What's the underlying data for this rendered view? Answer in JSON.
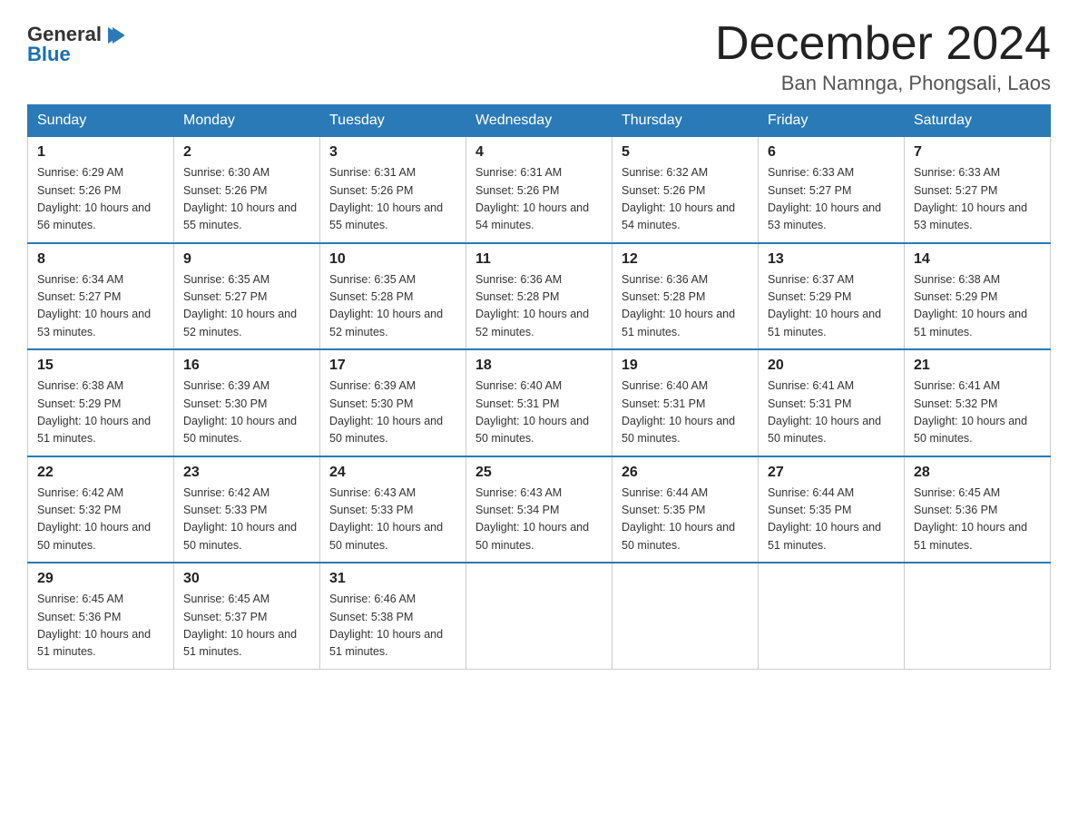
{
  "header": {
    "logo_line1": "General",
    "logo_line2": "Blue",
    "month_title": "December 2024",
    "location": "Ban Namnga, Phongsali, Laos"
  },
  "calendar": {
    "days_of_week": [
      "Sunday",
      "Monday",
      "Tuesday",
      "Wednesday",
      "Thursday",
      "Friday",
      "Saturday"
    ],
    "weeks": [
      [
        {
          "day": "1",
          "sunrise": "6:29 AM",
          "sunset": "5:26 PM",
          "daylight": "10 hours and 56 minutes."
        },
        {
          "day": "2",
          "sunrise": "6:30 AM",
          "sunset": "5:26 PM",
          "daylight": "10 hours and 55 minutes."
        },
        {
          "day": "3",
          "sunrise": "6:31 AM",
          "sunset": "5:26 PM",
          "daylight": "10 hours and 55 minutes."
        },
        {
          "day": "4",
          "sunrise": "6:31 AM",
          "sunset": "5:26 PM",
          "daylight": "10 hours and 54 minutes."
        },
        {
          "day": "5",
          "sunrise": "6:32 AM",
          "sunset": "5:26 PM",
          "daylight": "10 hours and 54 minutes."
        },
        {
          "day": "6",
          "sunrise": "6:33 AM",
          "sunset": "5:27 PM",
          "daylight": "10 hours and 53 minutes."
        },
        {
          "day": "7",
          "sunrise": "6:33 AM",
          "sunset": "5:27 PM",
          "daylight": "10 hours and 53 minutes."
        }
      ],
      [
        {
          "day": "8",
          "sunrise": "6:34 AM",
          "sunset": "5:27 PM",
          "daylight": "10 hours and 53 minutes."
        },
        {
          "day": "9",
          "sunrise": "6:35 AM",
          "sunset": "5:27 PM",
          "daylight": "10 hours and 52 minutes."
        },
        {
          "day": "10",
          "sunrise": "6:35 AM",
          "sunset": "5:28 PM",
          "daylight": "10 hours and 52 minutes."
        },
        {
          "day": "11",
          "sunrise": "6:36 AM",
          "sunset": "5:28 PM",
          "daylight": "10 hours and 52 minutes."
        },
        {
          "day": "12",
          "sunrise": "6:36 AM",
          "sunset": "5:28 PM",
          "daylight": "10 hours and 51 minutes."
        },
        {
          "day": "13",
          "sunrise": "6:37 AM",
          "sunset": "5:29 PM",
          "daylight": "10 hours and 51 minutes."
        },
        {
          "day": "14",
          "sunrise": "6:38 AM",
          "sunset": "5:29 PM",
          "daylight": "10 hours and 51 minutes."
        }
      ],
      [
        {
          "day": "15",
          "sunrise": "6:38 AM",
          "sunset": "5:29 PM",
          "daylight": "10 hours and 51 minutes."
        },
        {
          "day": "16",
          "sunrise": "6:39 AM",
          "sunset": "5:30 PM",
          "daylight": "10 hours and 50 minutes."
        },
        {
          "day": "17",
          "sunrise": "6:39 AM",
          "sunset": "5:30 PM",
          "daylight": "10 hours and 50 minutes."
        },
        {
          "day": "18",
          "sunrise": "6:40 AM",
          "sunset": "5:31 PM",
          "daylight": "10 hours and 50 minutes."
        },
        {
          "day": "19",
          "sunrise": "6:40 AM",
          "sunset": "5:31 PM",
          "daylight": "10 hours and 50 minutes."
        },
        {
          "day": "20",
          "sunrise": "6:41 AM",
          "sunset": "5:31 PM",
          "daylight": "10 hours and 50 minutes."
        },
        {
          "day": "21",
          "sunrise": "6:41 AM",
          "sunset": "5:32 PM",
          "daylight": "10 hours and 50 minutes."
        }
      ],
      [
        {
          "day": "22",
          "sunrise": "6:42 AM",
          "sunset": "5:32 PM",
          "daylight": "10 hours and 50 minutes."
        },
        {
          "day": "23",
          "sunrise": "6:42 AM",
          "sunset": "5:33 PM",
          "daylight": "10 hours and 50 minutes."
        },
        {
          "day": "24",
          "sunrise": "6:43 AM",
          "sunset": "5:33 PM",
          "daylight": "10 hours and 50 minutes."
        },
        {
          "day": "25",
          "sunrise": "6:43 AM",
          "sunset": "5:34 PM",
          "daylight": "10 hours and 50 minutes."
        },
        {
          "day": "26",
          "sunrise": "6:44 AM",
          "sunset": "5:35 PM",
          "daylight": "10 hours and 50 minutes."
        },
        {
          "day": "27",
          "sunrise": "6:44 AM",
          "sunset": "5:35 PM",
          "daylight": "10 hours and 51 minutes."
        },
        {
          "day": "28",
          "sunrise": "6:45 AM",
          "sunset": "5:36 PM",
          "daylight": "10 hours and 51 minutes."
        }
      ],
      [
        {
          "day": "29",
          "sunrise": "6:45 AM",
          "sunset": "5:36 PM",
          "daylight": "10 hours and 51 minutes."
        },
        {
          "day": "30",
          "sunrise": "6:45 AM",
          "sunset": "5:37 PM",
          "daylight": "10 hours and 51 minutes."
        },
        {
          "day": "31",
          "sunrise": "6:46 AM",
          "sunset": "5:38 PM",
          "daylight": "10 hours and 51 minutes."
        },
        null,
        null,
        null,
        null
      ]
    ],
    "labels": {
      "sunrise": "Sunrise: ",
      "sunset": "Sunset: ",
      "daylight": "Daylight: "
    }
  }
}
